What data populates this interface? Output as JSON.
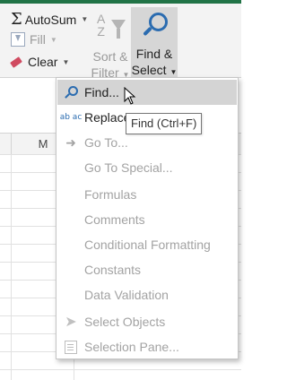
{
  "ribbon": {
    "autosum_label": "AutoSum",
    "fill_label": "Fill",
    "clear_label": "Clear",
    "sort_filter_line1": "Sort &",
    "sort_filter_line2": "Filter",
    "find_select_line1": "Find &",
    "find_select_line2": "Select",
    "sort_icon_text": "A Z"
  },
  "sheet": {
    "column_header": "M"
  },
  "menu": {
    "items": [
      {
        "label": "Find...",
        "icon": "magnifier-icon",
        "enabled": true,
        "hover": true
      },
      {
        "label": "Replace...",
        "icon": "replace-icon",
        "enabled": true
      },
      {
        "label": "Go To...",
        "icon": "arrow-right-icon",
        "enabled": false
      },
      {
        "label": "Go To Special...",
        "icon": "",
        "enabled": false
      },
      {
        "label": "Formulas",
        "icon": "",
        "enabled": false
      },
      {
        "label": "Comments",
        "icon": "",
        "enabled": false
      },
      {
        "label": "Conditional Formatting",
        "icon": "",
        "enabled": false
      },
      {
        "label": "Constants",
        "icon": "",
        "enabled": false
      },
      {
        "label": "Data Validation",
        "icon": "",
        "enabled": false
      },
      {
        "label": "Select Objects",
        "icon": "pointer-icon",
        "enabled": false
      },
      {
        "label": "Selection Pane...",
        "icon": "selection-pane-icon",
        "enabled": false
      }
    ],
    "replace_icon_text": "ab ac"
  },
  "tooltip": {
    "text": "Find (Ctrl+F)"
  },
  "colors": {
    "accent_green": "#217346",
    "find_blue": "#2b6cb0",
    "hover_gray": "#d4d4d4",
    "disabled_text": "#a3a3a3"
  }
}
